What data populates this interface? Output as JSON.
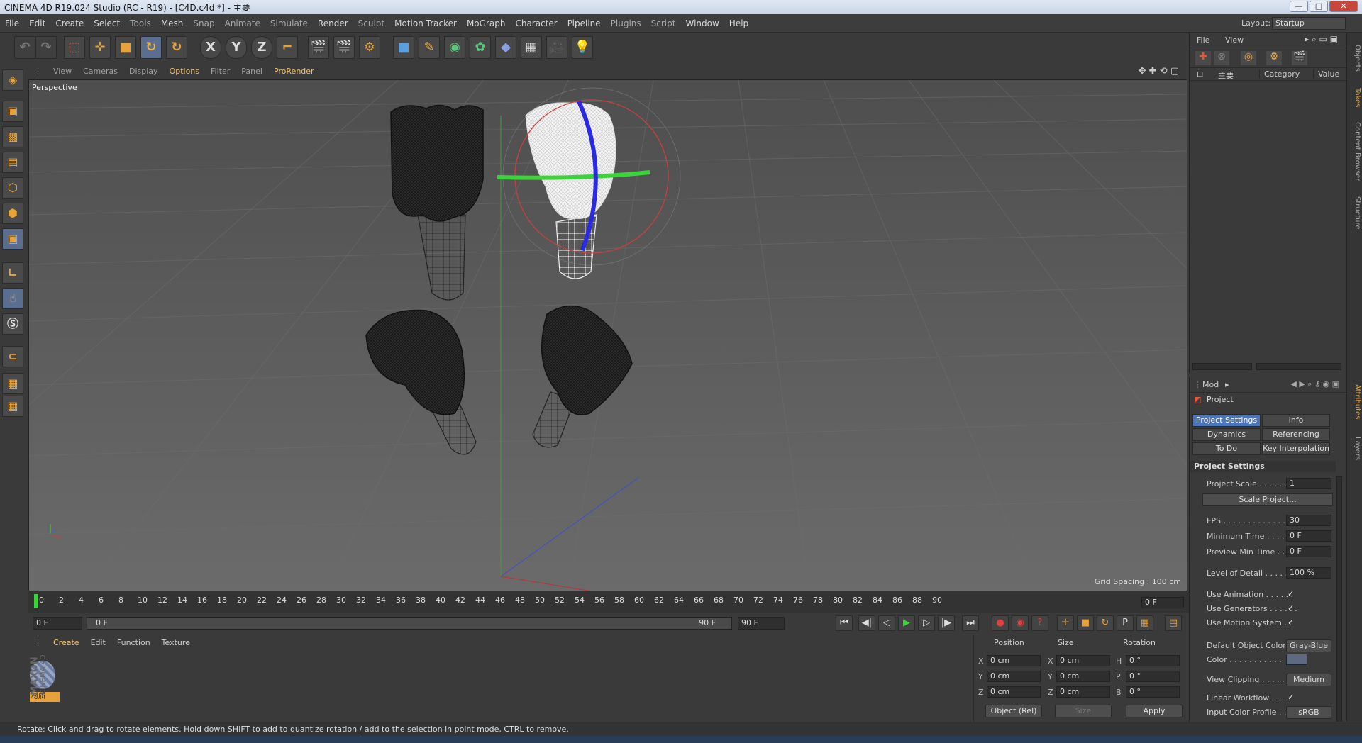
{
  "window": {
    "title": "CINEMA 4D R19.024 Studio (RC - R19) - [C4D.c4d *] - 主要",
    "buttons": {
      "minimize": "—",
      "maximize": "□",
      "close": "✕"
    }
  },
  "menubar": {
    "items": [
      "File",
      "Edit",
      "Create",
      "Select",
      "Tools",
      "Mesh",
      "Snap",
      "Animate",
      "Simulate",
      "Render",
      "Sculpt",
      "Motion Tracker",
      "MoGraph",
      "Character",
      "Pipeline",
      "Plugins",
      "Script",
      "Window",
      "Help"
    ],
    "layout_label": "Layout:",
    "layout_value": "Startup"
  },
  "toolbar": {
    "axis_x": "X",
    "axis_y": "Y",
    "axis_z": "Z"
  },
  "viewport": {
    "menu": [
      "View",
      "Cameras",
      "Display",
      "Options",
      "Filter",
      "Panel",
      "ProRender"
    ],
    "label": "Perspective",
    "grid_spacing": "Grid Spacing : 100 cm"
  },
  "timeline": {
    "ticks": [
      "0",
      "2",
      "4",
      "6",
      "8",
      "10",
      "12",
      "14",
      "16",
      "18",
      "20",
      "22",
      "24",
      "26",
      "28",
      "30",
      "32",
      "34",
      "36",
      "38",
      "40",
      "42",
      "44",
      "46",
      "48",
      "50",
      "52",
      "54",
      "56",
      "58",
      "60",
      "62",
      "64",
      "66",
      "68",
      "70",
      "72",
      "74",
      "76",
      "78",
      "80",
      "82",
      "84",
      "86",
      "88",
      "90"
    ],
    "current_frame": "0 F"
  },
  "transport": {
    "start_frame": "0 F",
    "range_start": "0 F",
    "range_end": "90 F",
    "end_frame": "90 F"
  },
  "material_manager": {
    "menu": [
      "Create",
      "Edit",
      "Function",
      "Texture"
    ],
    "material_name": "材质",
    "brand_top": "MAXON",
    "brand_bottom": "CINEMA 4D"
  },
  "coordinates": {
    "headers": {
      "position": "Position",
      "size": "Size",
      "rotation": "Rotation"
    },
    "axes_pos": [
      "X",
      "Y",
      "Z"
    ],
    "axes_rot": [
      "H",
      "P",
      "B"
    ],
    "position": [
      "0 cm",
      "0 cm",
      "0 cm"
    ],
    "size": [
      "0 cm",
      "0 cm",
      "0 cm"
    ],
    "rotation": [
      "0 °",
      "0 °",
      "0 °"
    ],
    "mode_select": "Object (Rel)",
    "size_select": "Size",
    "apply_label": "Apply"
  },
  "object_manager": {
    "menu": [
      "File",
      "View"
    ],
    "columns": {
      "name": "主要",
      "category": "Category",
      "value": "Value"
    }
  },
  "attributes": {
    "menu_mode": "Mod",
    "title": "Project",
    "tabs": [
      "Project Settings",
      "Info",
      "Dynamics",
      "Referencing",
      "To Do",
      "Key Interpolation"
    ],
    "section": "Project Settings",
    "rows": [
      {
        "label": "Project Scale . . . . . . .",
        "value": "1"
      },
      {
        "label": "FPS . . . . . . . . . . . . . . .",
        "value": "30"
      },
      {
        "label": "Minimum Time . . . . . .",
        "value": "0 F"
      },
      {
        "label": "Preview Min Time . . . .",
        "value": "0 F"
      },
      {
        "label": "Level of Detail . . . . . .",
        "value": "100 %"
      }
    ],
    "scale_button": "Scale Project...",
    "checks": [
      {
        "label": "Use Animation . . . . . .",
        "checked": "✓"
      },
      {
        "label": "Use Generators . . . . . .",
        "checked": "✓"
      },
      {
        "label": "Use Motion System . .",
        "checked": "✓"
      }
    ],
    "default_color_label": "Default Object Color",
    "default_color_value": "Gray-Blue",
    "color_label": "Color . . . . . . . . . . .",
    "view_clipping_label": "View Clipping . . . . . .",
    "view_clipping_value": "Medium",
    "linear_workflow_label": "Linear Workflow . . . .",
    "linear_workflow_value": "✓",
    "input_profile_label": "Input Color Profile . . .",
    "input_profile_value": "sRGB"
  },
  "side_tabs": [
    "Objects",
    "Takes",
    "Content Browser",
    "Structure",
    "Attributes",
    "Layers"
  ],
  "status": {
    "text": "Rotate: Click and drag to rotate elements. Hold down SHIFT to add to quantize rotation / add to the selection in point mode, CTRL to remove."
  }
}
